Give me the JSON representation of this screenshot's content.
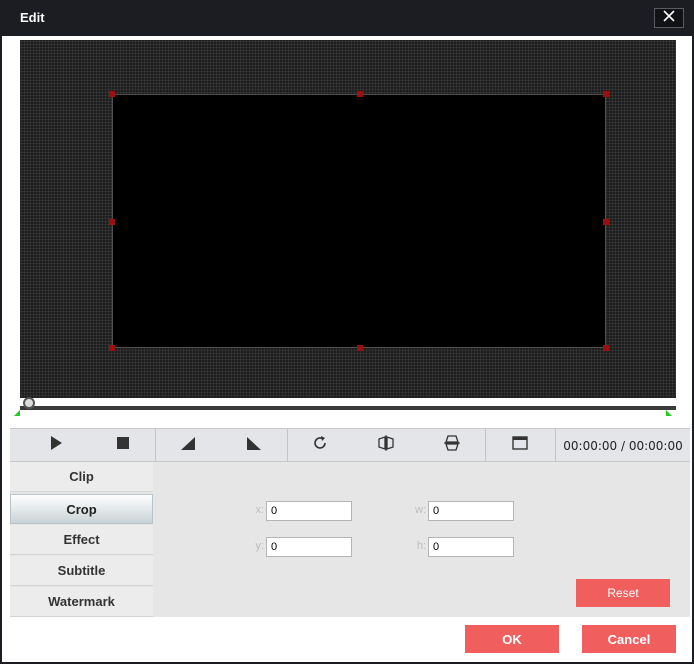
{
  "window": {
    "title": "Edit"
  },
  "icons": {
    "close": "close-icon",
    "play": "play-icon",
    "stop": "stop-icon",
    "brightness_down": "triangle-left-icon",
    "brightness_up": "triangle-right-icon",
    "rotate": "rotate-icon",
    "flip_horizontal": "flip-horizontal-icon",
    "flip_vertical": "flip-vertical-icon",
    "aspect": "aspect-ratio-icon"
  },
  "player": {
    "time": "00:00:00 / 00:00:00"
  },
  "tabs": [
    {
      "label": "Clip"
    },
    {
      "label": "Crop"
    },
    {
      "label": "Effect"
    },
    {
      "label": "Subtitle"
    },
    {
      "label": "Watermark"
    }
  ],
  "crop": {
    "x_label": "x:",
    "x_value": "0",
    "y_label": "y:",
    "y_value": "0",
    "w_label": "w:",
    "w_value": "0",
    "h_label": "h:",
    "h_value": "0",
    "reset_label": "Reset"
  },
  "footer": {
    "ok_label": "OK",
    "cancel_label": "Cancel"
  },
  "colors": {
    "accent": "#f15e5e",
    "titlebar": "#1c1d22",
    "handle": "#9a1010",
    "trim_marker": "#22cc22"
  }
}
